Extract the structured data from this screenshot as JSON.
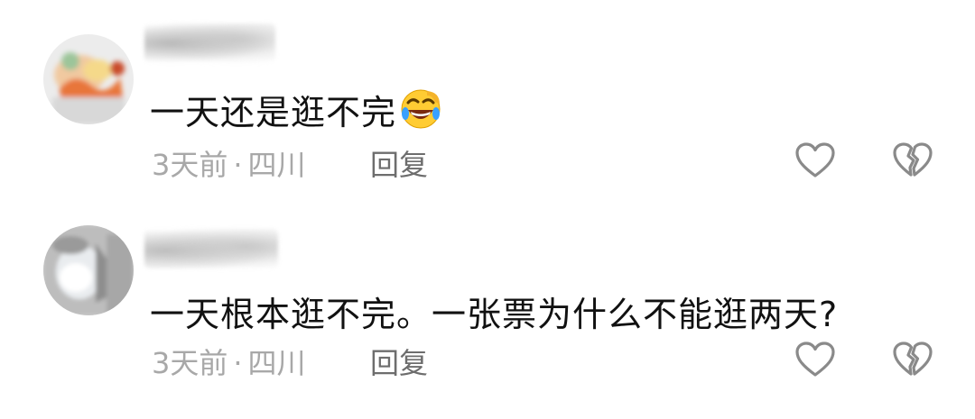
{
  "comments": [
    {
      "text": "一天还是逛不完",
      "emoji": "rolling-on-floor-laughing-emoji",
      "time": "3天前",
      "location": "四川",
      "separator": "·",
      "reply_label": "回复"
    },
    {
      "text": "一天根本逛不完。一张票为什么不能逛两天?",
      "time": "3天前",
      "location": "四川",
      "separator": "·",
      "reply_label": "回复"
    }
  ],
  "icons": {
    "like": "heart-outline-icon",
    "dislike": "broken-heart-outline-icon"
  },
  "colors": {
    "text": "#111111",
    "meta": "#a8a8a8",
    "reply": "#6d6d6d",
    "icon": "#8a8a8a"
  }
}
